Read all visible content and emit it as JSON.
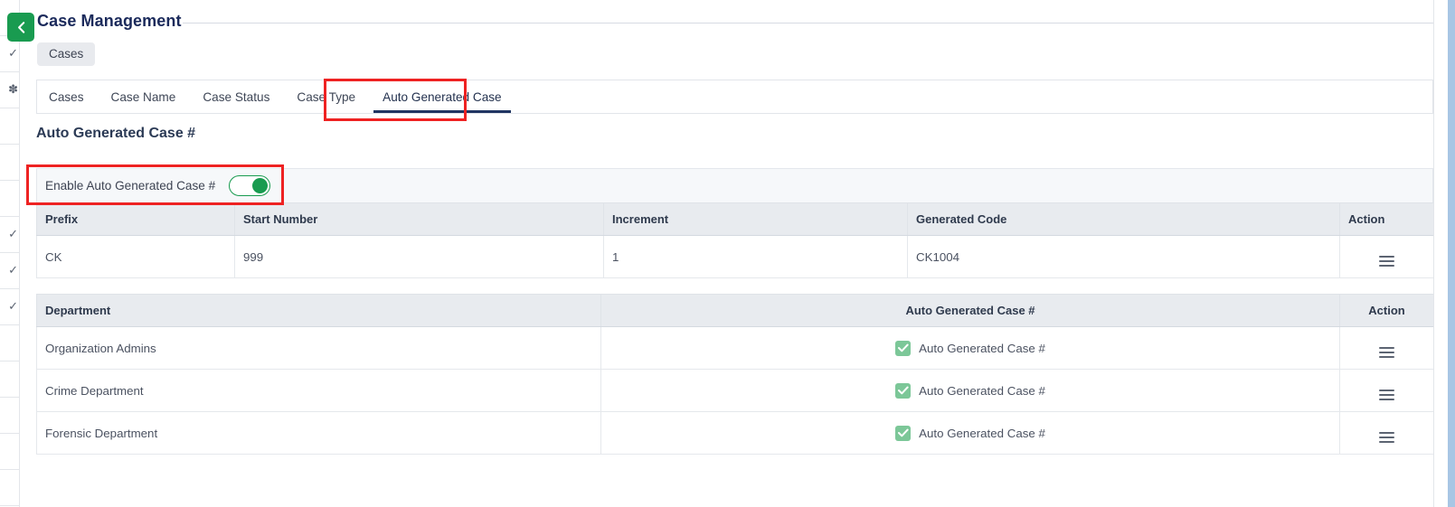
{
  "header": {
    "back_icon": "chevron-left-icon",
    "title": "Case Management",
    "breadcrumb": "Cases"
  },
  "tabs": [
    {
      "label": "Cases",
      "active": false
    },
    {
      "label": "Case Name",
      "active": false
    },
    {
      "label": "Case Status",
      "active": false
    },
    {
      "label": "Case Type",
      "active": false
    },
    {
      "label": "Auto Generated Case",
      "active": true
    }
  ],
  "section": {
    "title": "Auto Generated Case #",
    "toggle_label": "Enable Auto Generated Case #",
    "toggle_state": "on"
  },
  "config_table": {
    "columns": [
      "Prefix",
      "Start Number",
      "Increment",
      "Generated Code",
      "Action"
    ],
    "rows": [
      {
        "prefix": "CK",
        "start_number": "999",
        "increment": "1",
        "generated_code": "CK1004",
        "action_icon": "hamburger-menu-icon"
      }
    ]
  },
  "department_table": {
    "columns": [
      "Department",
      "Auto Generated Case #",
      "Action"
    ],
    "rows": [
      {
        "department": "Organization Admins",
        "option_label": "Auto Generated Case #",
        "checked": true,
        "action_icon": "hamburger-menu-icon"
      },
      {
        "department": "Crime Department",
        "option_label": "Auto Generated Case #",
        "checked": true,
        "action_icon": "hamburger-menu-icon"
      },
      {
        "department": "Forensic Department",
        "option_label": "Auto Generated Case #",
        "checked": true,
        "action_icon": "hamburger-menu-icon"
      }
    ]
  },
  "annotations": [
    {
      "name": "highlight-active-tab",
      "color": "#ee2222"
    },
    {
      "name": "highlight-enable-toggle",
      "color": "#ee2222"
    }
  ],
  "colors": {
    "brand_green": "#199b50",
    "title_navy": "#1b2a5b",
    "tab_underline": "#203562",
    "checkbox_green": "#7cc798",
    "annotation_red": "#ee2222",
    "header_row": "#e8ebef",
    "band": "#f6f8fa"
  }
}
